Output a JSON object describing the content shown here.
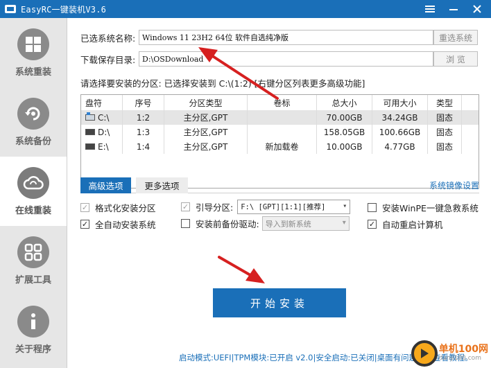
{
  "window": {
    "title": "EasyRC一键装机V3.6"
  },
  "sidebar": {
    "items": [
      {
        "label": "系统重装",
        "icon": "windows-icon"
      },
      {
        "label": "系统备份",
        "icon": "backup-icon"
      },
      {
        "label": "在线重装",
        "icon": "cloud-icon"
      },
      {
        "label": "扩展工具",
        "icon": "tools-icon"
      },
      {
        "label": "关于程序",
        "icon": "info-icon"
      }
    ]
  },
  "form": {
    "system_label": "已选系统名称:",
    "system_value": "Windows 11 23H2   64位 软件自选纯净版",
    "reselect_btn": "重选系统",
    "save_dir_label": "下载保存目录:",
    "save_dir_value": "D:\\OSDownload",
    "browse_btn": "浏 览",
    "partition_hint": "请选择要安装的分区: 已选择安装到 C:\\(1:2) [右键分区列表更多高级功能]"
  },
  "table": {
    "headers": [
      "盘符",
      "序号",
      "分区类型",
      "卷标",
      "总大小",
      "可用大小",
      "类型"
    ],
    "rows": [
      {
        "drive": "C:\\",
        "index": "1:2",
        "ptype": "主分区,GPT",
        "label": "",
        "total": "70.00GB",
        "free": "34.24GB",
        "kind": "固态"
      },
      {
        "drive": "D:\\",
        "index": "1:3",
        "ptype": "主分区,GPT",
        "label": "",
        "total": "158.05GB",
        "free": "100.66GB",
        "kind": "固态"
      },
      {
        "drive": "E:\\",
        "index": "1:4",
        "ptype": "主分区,GPT",
        "label": "新加载卷",
        "total": "10.00GB",
        "free": "4.77GB",
        "kind": "固态"
      }
    ]
  },
  "tabs": {
    "advanced": "高级选项",
    "more": "更多选项",
    "mirror_link": "系统镜像设置"
  },
  "options": {
    "format_partition": "格式化安装分区",
    "boot_partition": "引导分区:",
    "boot_select": "F:\\ [GPT][1:1][推荐]",
    "install_winpe": "安装WinPE一键急救系统",
    "auto_install": "全自动安装系统",
    "backup_drivers": "安装前备份驱动:",
    "driver_select": "导入到新系统",
    "auto_restart": "自动重启计算机"
  },
  "start_button": "开始安装",
  "status": "启动模式:UEFI|TPM模块:已开启 v2.0|安全启动:已关闭|桌面有问题点击查看教程。",
  "watermark": {
    "brand": "单机100网",
    "site": "danji100.com"
  }
}
